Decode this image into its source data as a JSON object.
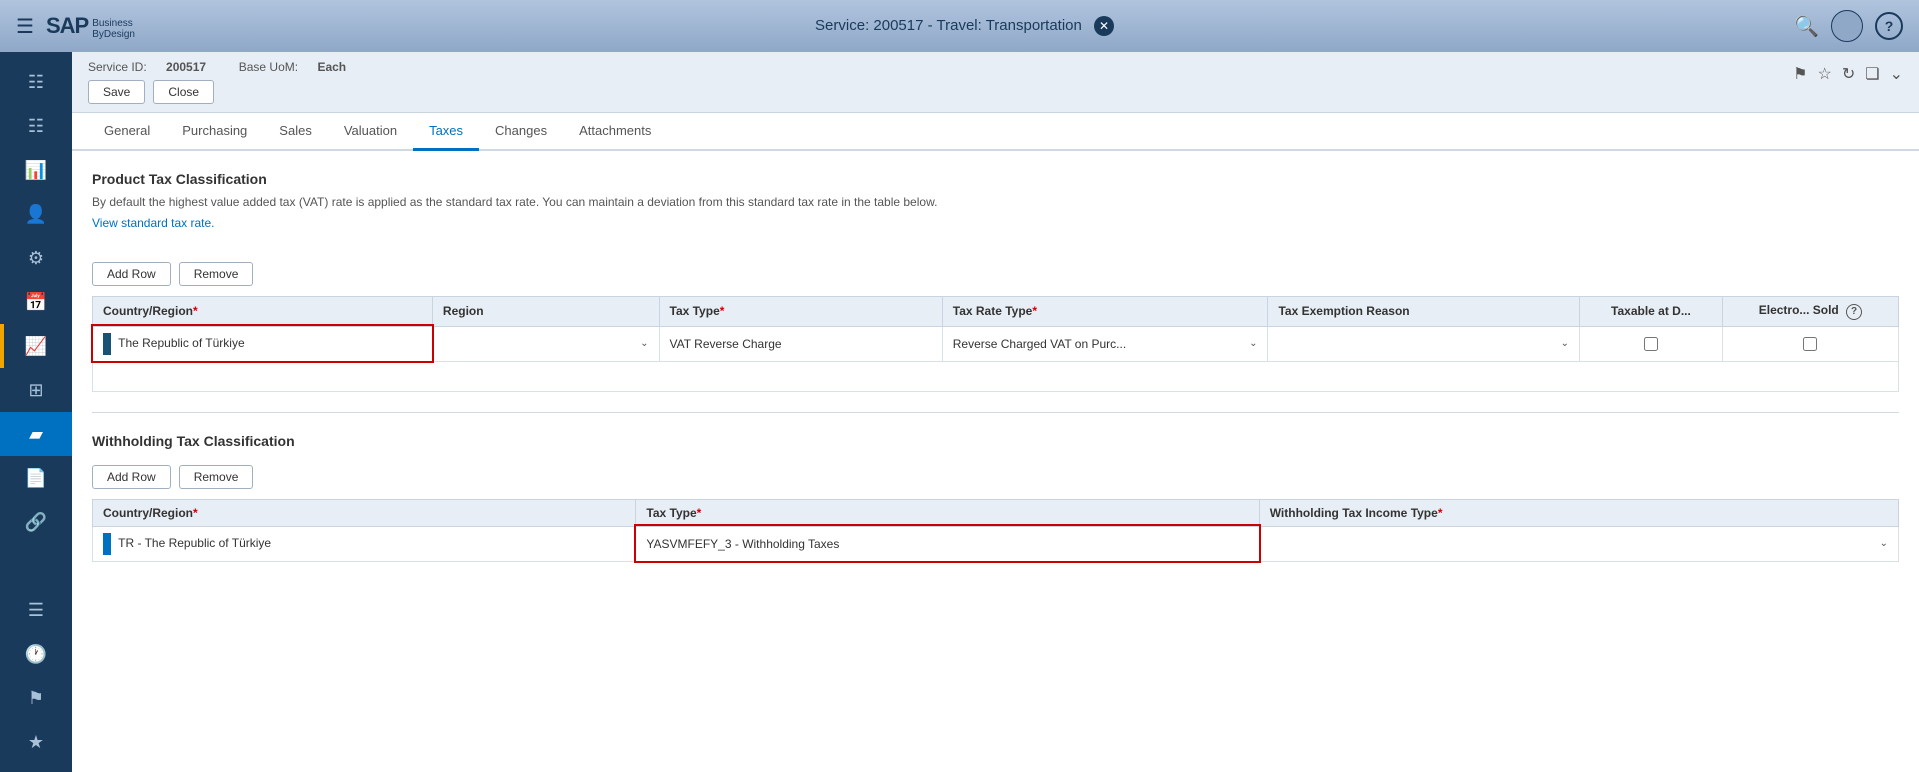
{
  "header": {
    "title": "Service: 200517 - Travel: Transportation",
    "close_label": "✕"
  },
  "subheader": {
    "service_id_label": "Service ID:",
    "service_id_value": "200517",
    "base_uom_label": "Base UoM:",
    "base_uom_value": "Each",
    "save_button": "Save",
    "close_button": "Close"
  },
  "tabs": [
    {
      "id": "general",
      "label": "General"
    },
    {
      "id": "purchasing",
      "label": "Purchasing"
    },
    {
      "id": "sales",
      "label": "Sales"
    },
    {
      "id": "valuation",
      "label": "Valuation"
    },
    {
      "id": "taxes",
      "label": "Taxes",
      "active": true
    },
    {
      "id": "changes",
      "label": "Changes"
    },
    {
      "id": "attachments",
      "label": "Attachments"
    }
  ],
  "product_tax": {
    "section_title": "Product Tax Classification",
    "description": "By default the highest value added tax (VAT) rate is applied as the standard tax rate. You can maintain a deviation from this standard tax rate in the table below.",
    "view_link": "View standard tax rate.",
    "add_row_button": "Add Row",
    "remove_button": "Remove",
    "table_headers": {
      "country_region": "Country/Region",
      "region": "Region",
      "tax_type": "Tax Type",
      "tax_rate_type": "Tax Rate Type",
      "tax_exemption_reason": "Tax Exemption Reason",
      "taxable_at_d": "Taxable at D...",
      "electro_sold": "Electro... Sold"
    },
    "table_row": {
      "country": "The Republic of Türkiye",
      "region": "",
      "tax_type": "VAT Reverse Charge",
      "tax_rate_type": "Reverse Charged VAT on Purc...",
      "tax_exemption_reason": "",
      "taxable_at_d": false,
      "electro_sold": false
    }
  },
  "withholding_tax": {
    "section_title": "Withholding Tax Classification",
    "add_row_button": "Add Row",
    "remove_button": "Remove",
    "table_headers": {
      "country_region": "Country/Region",
      "tax_type": "Tax Type",
      "withholding_tax_income_type": "Withholding Tax Income Type"
    },
    "table_row": {
      "country": "TR - The Republic of Türkiye",
      "tax_type": "YASVMFEFY_3 - Withholding Taxes",
      "withholding_tax_income_type": ""
    }
  },
  "sidebar": {
    "items": [
      {
        "icon": "☰",
        "name": "home"
      },
      {
        "icon": "📊",
        "name": "dashboard"
      },
      {
        "icon": "👥",
        "name": "users"
      },
      {
        "icon": "👤",
        "name": "person"
      },
      {
        "icon": "🔧",
        "name": "operations"
      },
      {
        "icon": "📋",
        "name": "orders"
      },
      {
        "icon": "📈",
        "name": "analytics"
      },
      {
        "icon": "🔲",
        "name": "grid"
      },
      {
        "icon": "📦",
        "name": "products",
        "active": true
      },
      {
        "icon": "📄",
        "name": "documents"
      },
      {
        "icon": "🔗",
        "name": "links"
      },
      {
        "icon": "☰",
        "name": "list"
      },
      {
        "icon": "🕐",
        "name": "time"
      },
      {
        "icon": "🚩",
        "name": "flags"
      },
      {
        "icon": "⭐",
        "name": "favorites"
      }
    ]
  }
}
